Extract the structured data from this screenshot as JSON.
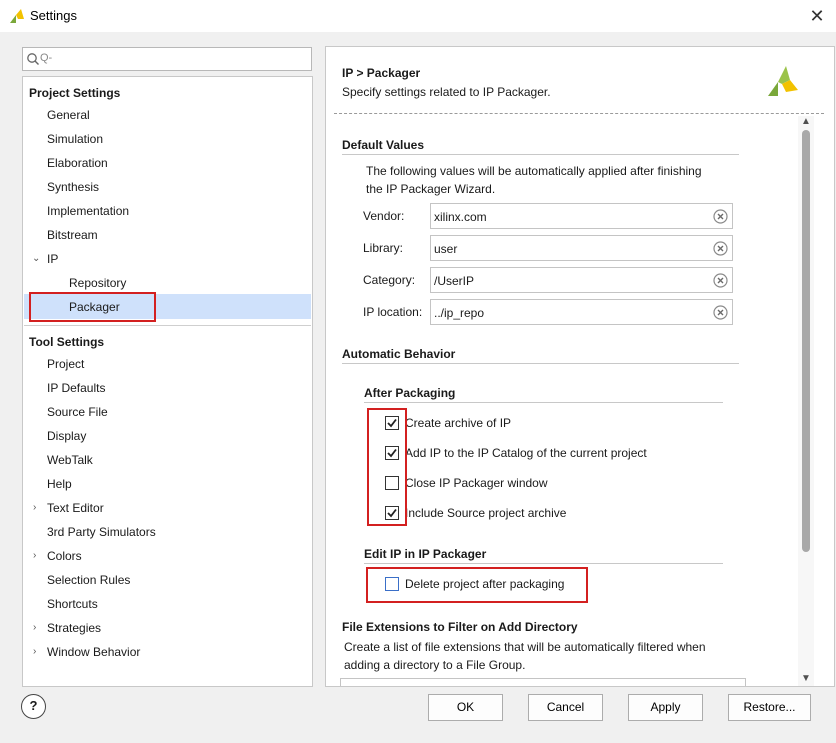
{
  "window": {
    "title": "Settings",
    "close_glyph": "✕"
  },
  "search": {
    "placeholder": "Q-"
  },
  "tree": {
    "project_settings_label": "Project Settings",
    "project_items": [
      "General",
      "Simulation",
      "Elaboration",
      "Synthesis",
      "Implementation",
      "Bitstream"
    ],
    "ip_label": "IP",
    "ip_children": [
      "Repository",
      "Packager"
    ],
    "selected": "Packager",
    "tool_settings_label": "Tool Settings",
    "tool_items": [
      {
        "label": "Project",
        "expandable": false
      },
      {
        "label": "IP Defaults",
        "expandable": false
      },
      {
        "label": "Source File",
        "expandable": false
      },
      {
        "label": "Display",
        "expandable": false
      },
      {
        "label": "WebTalk",
        "expandable": false
      },
      {
        "label": "Help",
        "expandable": false
      },
      {
        "label": "Text Editor",
        "expandable": true
      },
      {
        "label": "3rd Party Simulators",
        "expandable": false
      },
      {
        "label": "Colors",
        "expandable": true
      },
      {
        "label": "Selection Rules",
        "expandable": false
      },
      {
        "label": "Shortcuts",
        "expandable": false
      },
      {
        "label": "Strategies",
        "expandable": true
      },
      {
        "label": "Window Behavior",
        "expandable": true
      }
    ]
  },
  "panel": {
    "title": "IP > Packager",
    "subtitle": "Specify settings related to IP Packager.",
    "default_values": {
      "title": "Default Values",
      "desc_line1": "The following values will be automatically applied after finishing",
      "desc_line2": "the IP Packager Wizard.",
      "vendor_label": "Vendor:",
      "vendor_value": "xilinx.com",
      "library_label": "Library:",
      "library_value": "user",
      "category_label": "Category:",
      "category_value": "/UserIP",
      "iploc_label": "IP location:",
      "iploc_value": "../ip_repo"
    },
    "automatic_behavior": {
      "title": "Automatic Behavior"
    },
    "after_packaging": {
      "title": "After Packaging",
      "options": [
        {
          "label": "Create archive of IP",
          "checked": true
        },
        {
          "label": "Add IP to the IP Catalog of the current project",
          "checked": true
        },
        {
          "label": "Close IP Packager window",
          "checked": false
        },
        {
          "label": "Include Source project archive",
          "checked": true
        }
      ]
    },
    "edit_ip": {
      "title": "Edit IP in IP Packager",
      "option_label": "Delete project after packaging",
      "checked": false
    },
    "file_ext": {
      "title": "File Extensions to Filter on Add Directory",
      "desc_line1": "Create a list of file extensions that will be automatically filtered when",
      "desc_line2": "adding a directory to a File Group."
    }
  },
  "buttons": {
    "help": "?",
    "ok": "OK",
    "cancel": "Cancel",
    "apply": "Apply",
    "restore": "Restore..."
  },
  "colors": {
    "selection": "#cfe1fb",
    "highlight_red": "#d32020",
    "logo_yellow": "#f2c200",
    "logo_green": "#7aa83a"
  }
}
